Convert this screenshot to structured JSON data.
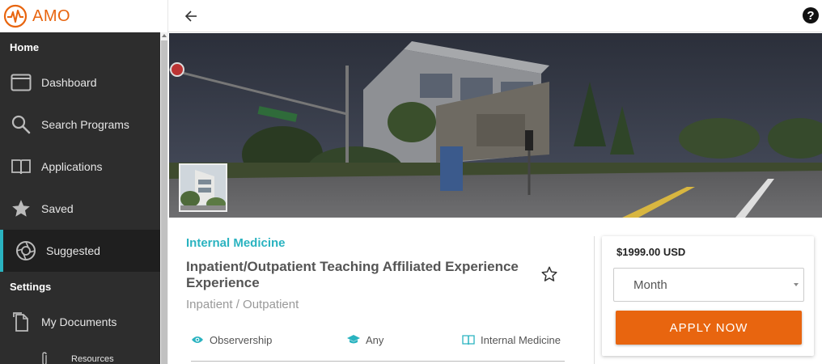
{
  "brand": {
    "name": "AMO",
    "color": "#e8650f"
  },
  "sidebar": {
    "home_heading": "Home",
    "items": [
      {
        "label": "Dashboard",
        "icon": "dashboard-icon"
      },
      {
        "label": "Search Programs",
        "icon": "search-icon"
      },
      {
        "label": "Applications",
        "icon": "book-icon"
      },
      {
        "label": "Saved",
        "icon": "star-icon"
      },
      {
        "label": "Suggested",
        "icon": "aperture-icon",
        "active": true
      }
    ],
    "settings_heading": "Settings",
    "settings_items": [
      {
        "label": "My Documents",
        "icon": "documents-icon"
      }
    ],
    "sub_items": [
      {
        "label": "Resources",
        "icon": "paperclip-icon"
      }
    ],
    "active_color": "#2ab3c0"
  },
  "topbar": {
    "back_icon": "arrow-left-icon",
    "help_label": "?"
  },
  "program": {
    "category": "Internal Medicine",
    "title": "Inpatient/Outpatient Teaching Affiliated Experience Experience",
    "subtitle": "Inpatient / Outpatient",
    "tags": [
      {
        "label": "Observership",
        "icon": "eye-icon"
      },
      {
        "label": "Any",
        "icon": "graduation-cap-icon"
      },
      {
        "label": "Internal Medicine",
        "icon": "book-icon"
      }
    ],
    "accent": "#2ab3c0"
  },
  "pricing": {
    "price": "$1999.00 USD",
    "period_selected": "Month",
    "apply_label": "APPLY NOW",
    "apply_color": "#e8650f"
  }
}
